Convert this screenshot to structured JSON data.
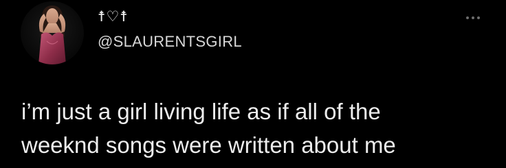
{
  "tweet": {
    "display_name": "☨♡☨",
    "handle": "@SLAURENTSGIRL",
    "text": "i’m just a girl living life as if all of the\nweeknd songs were written about me",
    "more_icon": "more-horizontal-icon"
  },
  "colors": {
    "background": "#000000",
    "text": "#ededed",
    "muted": "#6e6e6e",
    "dress": "#9a3a55"
  }
}
